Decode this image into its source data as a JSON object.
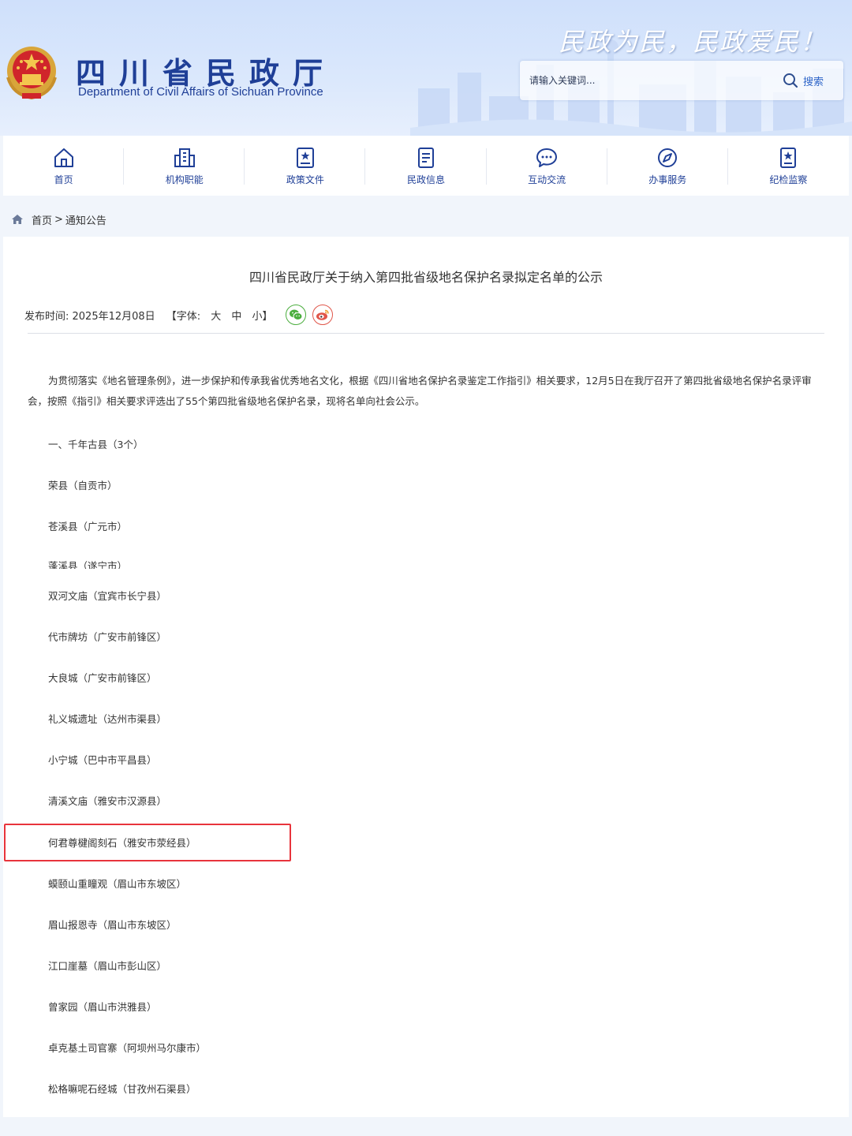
{
  "header": {
    "site_title": "四川省民政厅",
    "site_subtitle": "Department of Civil Affairs of Sichuan Province",
    "slogan": "民政为民，民政爱民！",
    "search_placeholder": "请输入关键词...",
    "search_label": "搜索"
  },
  "nav": {
    "items": [
      {
        "label": "首页",
        "icon": "home-icon"
      },
      {
        "label": "机构职能",
        "icon": "building-icon"
      },
      {
        "label": "政策文件",
        "icon": "policy-doc-icon"
      },
      {
        "label": "民政信息",
        "icon": "document-icon"
      },
      {
        "label": "互动交流",
        "icon": "chat-icon"
      },
      {
        "label": "办事服务",
        "icon": "compass-icon"
      },
      {
        "label": "纪检监察",
        "icon": "badge-icon"
      }
    ]
  },
  "breadcrumb": {
    "home": "首页",
    "separator": ">",
    "current": "通知公告"
  },
  "article": {
    "title": "四川省民政厅关于纳入第四批省级地名保护名录拟定名单的公示",
    "publish_time": "发布时间: 2025年12月08日",
    "font_size_open": "【字体:",
    "font_large": "大",
    "font_medium": "中",
    "font_small": "小】",
    "intro": "为贯彻落实《地名管理条例》，进一步保护和传承我省优秀地名文化，根据《四川省地名保护名录鉴定工作指引》相关要求，12月5日在我厅召开了第四批省级地名保护名录评审会，按照《指引》相关要求评选出了55个第四批省级地名保护名录，现将名单向社会公示。",
    "items": [
      "一、千年古县（3个）",
      "荣县（自贡市）",
      "苍溪县（广元市）",
      "蓬溪县（遂宁市）",
      "双河文庙（宜宾市长宁县）",
      "代市牌坊（广安市前锋区）",
      "大良城（广安市前锋区）",
      "礼义城遗址（达州市渠县）",
      "小宁城（巴中市平昌县）",
      "清溪文庙（雅安市汉源县）",
      "何君尊楗阁刻石（雅安市荥经县）",
      "蟆颐山重瞳观（眉山市东坡区）",
      "眉山报恩寺（眉山市东坡区）",
      "江口崖墓（眉山市彭山区）",
      "曾家园（眉山市洪雅县）",
      "卓克基土司官寨（阿坝州马尔康市）",
      "松格嘛呢石经城（甘孜州石渠县）"
    ]
  },
  "colors": {
    "brand_blue": "#1f3f97",
    "highlight_red": "#e8343c",
    "wechat_green": "#4cae3f",
    "weibo_red": "#e0564a"
  }
}
